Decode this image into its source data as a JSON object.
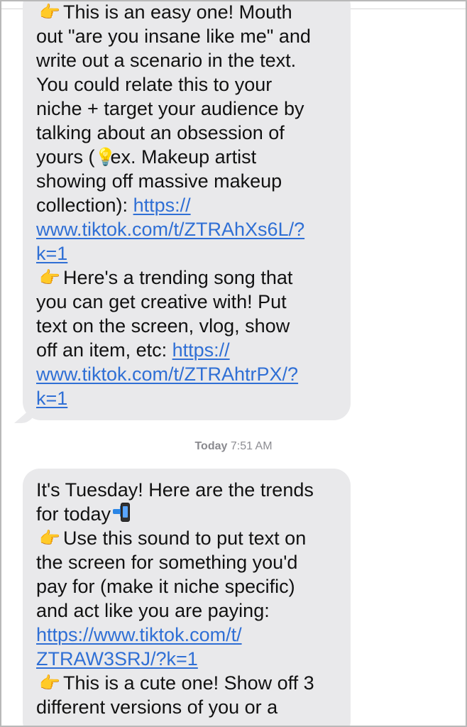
{
  "messages": [
    {
      "lines": [
        {
          "emoji": "👉",
          "text": "This is an easy one! Mouth"
        },
        {
          "text": "out \"are you insane like me\" and"
        },
        {
          "text": "write out a scenario in the text."
        },
        {
          "text": "You could relate this to your"
        },
        {
          "text": "niche + target your audience by"
        },
        {
          "text": "talking about an obsession of"
        },
        {
          "text_before": "yours (",
          "emoji": "💡",
          "text_after": "ex. Makeup artist"
        },
        {
          "text": "showing off massive makeup"
        },
        {
          "text": "collection): ",
          "link": "https://"
        },
        {
          "link": "www.tiktok.com/t/ZTRAhXs6L/?"
        },
        {
          "link": "k=1"
        },
        {
          "emoji": "👉",
          "text": "Here's a trending song that"
        },
        {
          "text": "you can get creative with! Put"
        },
        {
          "text": "text on the screen, vlog, show"
        },
        {
          "text": "off an item, etc: ",
          "link": "https://"
        },
        {
          "link": "www.tiktok.com/t/ZTRAhtrPX/?"
        },
        {
          "link": "k=1"
        }
      ]
    },
    {
      "timestamp": {
        "day": "Today",
        "time": "7:51 AM"
      }
    },
    {
      "lines": [
        {
          "text": "It's Tuesday! Here are the trends"
        },
        {
          "text": "for today",
          "icon": "mobile-phone-with-arrow-icon"
        },
        {
          "emoji": "👉",
          "text": "Use this sound to put text on"
        },
        {
          "text": "the screen for something you'd"
        },
        {
          "text": "pay for (make it niche specific)"
        },
        {
          "text": "and act like you are paying:"
        },
        {
          "link": "https://www.tiktok.com/t/"
        },
        {
          "link": "ZTRAW3SRJ/?k=1"
        },
        {
          "emoji": "👉",
          "text": "This is a cute one! Show off 3"
        },
        {
          "text": "different versions of you or a"
        }
      ]
    }
  ],
  "colors": {
    "bubble": "#e9e9eb",
    "link": "#2f6fd5",
    "timestamp": "#8d8d92",
    "background": "#ffffff"
  },
  "icons": [
    "backhand-index-pointing-right-icon",
    "light-bulb-icon",
    "mobile-phone-with-arrow-icon"
  ]
}
